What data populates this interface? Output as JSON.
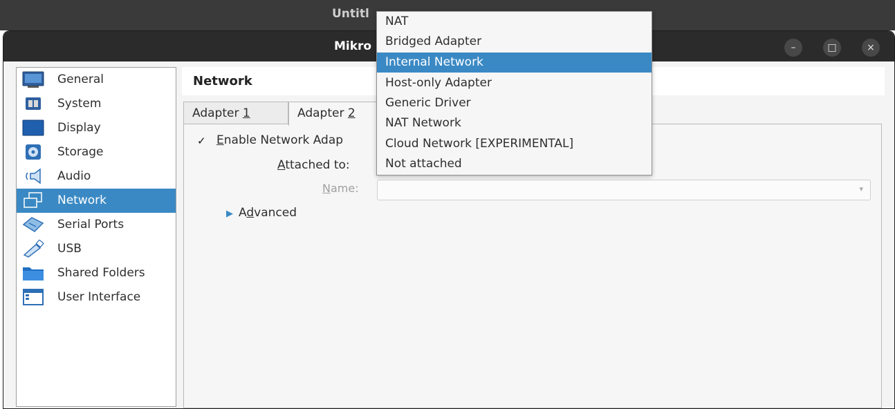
{
  "background_window": {
    "title": "Untitl"
  },
  "window": {
    "title": "Mikro",
    "controls": {
      "minimize": "–",
      "maximize": "□",
      "close": "×"
    }
  },
  "sidebar": {
    "selected_index": 5,
    "items": [
      {
        "label": "General",
        "icon": "general-icon"
      },
      {
        "label": "System",
        "icon": "system-icon"
      },
      {
        "label": "Display",
        "icon": "display-icon"
      },
      {
        "label": "Storage",
        "icon": "storage-icon"
      },
      {
        "label": "Audio",
        "icon": "audio-icon"
      },
      {
        "label": "Network",
        "icon": "network-icon"
      },
      {
        "label": "Serial Ports",
        "icon": "serial-ports-icon"
      },
      {
        "label": "USB",
        "icon": "usb-icon"
      },
      {
        "label": "Shared Folders",
        "icon": "shared-folders-icon"
      },
      {
        "label": "User Interface",
        "icon": "user-interface-icon"
      }
    ]
  },
  "page": {
    "title": "Network"
  },
  "tabs": [
    {
      "label": "Adapter ",
      "accel": "1",
      "active": false
    },
    {
      "label": "Adapter ",
      "accel": "2",
      "active": true
    }
  ],
  "adapter": {
    "enable_checked": true,
    "check_mark": "✓",
    "enable_pre": "",
    "enable_accel": "E",
    "enable_rest": "nable Network Adap",
    "attached_accel": "A",
    "attached_rest": "ttached to:",
    "name_accel": "N",
    "name_rest": "ame:",
    "name_value": "",
    "combo_arrow": "▾",
    "advanced_arrow": "▶",
    "advanced_pre": "A",
    "advanced_accel": "d",
    "advanced_rest": "vanced"
  },
  "dropdown": {
    "highlighted_index": 2,
    "options": [
      "NAT",
      "Bridged Adapter",
      "Internal Network",
      "Host-only Adapter",
      "Generic Driver",
      "NAT Network",
      "Cloud Network [EXPERIMENTAL]",
      "Not attached"
    ]
  },
  "colors": {
    "selection": "#3a89c4",
    "titlebar": "#2b2b2b",
    "window_bg": "#f4f4f4"
  }
}
